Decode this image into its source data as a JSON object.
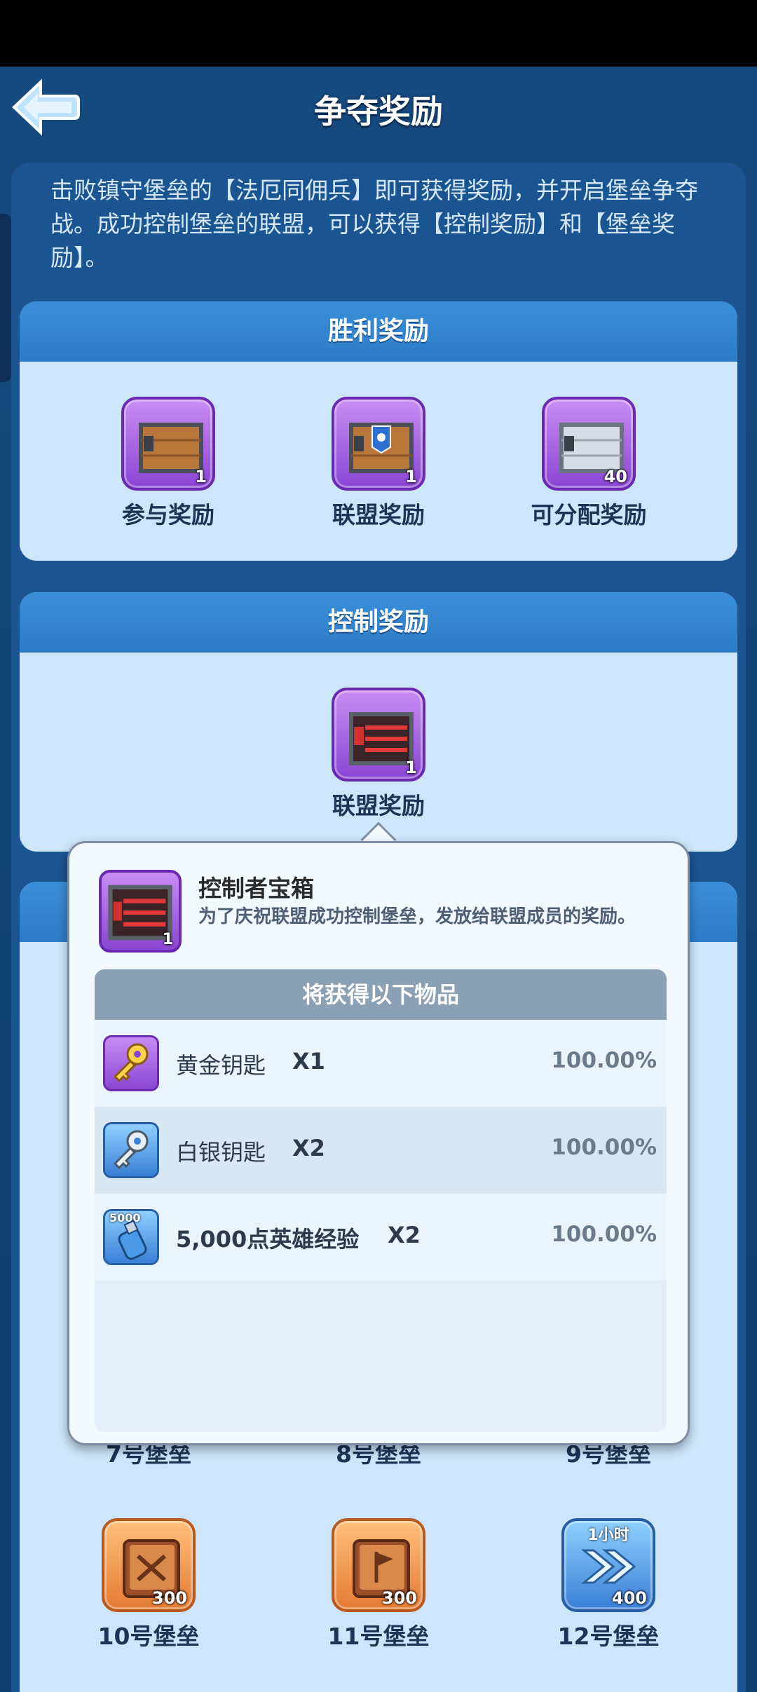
{
  "header": {
    "title": "争夺奖励"
  },
  "intro": "击败镇守堡垒的【法厄同佣兵】即可获得奖励，并开启堡垒争夺战。成功控制堡垒的联盟，可以获得【控制奖励】和【堡垒奖励】。",
  "victory": {
    "title": "胜利奖励",
    "items": [
      {
        "label": "参与奖励",
        "count": "1"
      },
      {
        "label": "联盟奖励",
        "count": "1"
      },
      {
        "label": "可分配奖励",
        "count": "40"
      }
    ]
  },
  "control": {
    "title": "控制奖励",
    "items": [
      {
        "label": "联盟奖励",
        "count": "1"
      }
    ]
  },
  "popup": {
    "title": "控制者宝箱",
    "description": "为了庆祝联盟成功控制堡垒，发放给联盟成员的奖励。",
    "icon_count": "1",
    "list_title": "将获得以下物品",
    "items": [
      {
        "name": "黄金钥匙",
        "qty": "X1",
        "pct": "100.00%",
        "icon": "gold-key-icon"
      },
      {
        "name": "白银钥匙",
        "qty": "X2",
        "pct": "100.00%",
        "icon": "silver-key-icon"
      },
      {
        "name": "5,000点英雄经验",
        "qty": "X2",
        "pct": "100.00%",
        "icon": "exp-bottle-icon",
        "badge": "5000"
      }
    ]
  },
  "castles": {
    "row1": [
      "7号堡垒",
      "8号堡垒",
      "9号堡垒"
    ],
    "row2": [
      {
        "label": "10号堡垒",
        "count": "300"
      },
      {
        "label": "11号堡垒",
        "count": "300"
      },
      {
        "label": "12号堡垒",
        "count": "400",
        "badge": "1小时"
      }
    ]
  }
}
